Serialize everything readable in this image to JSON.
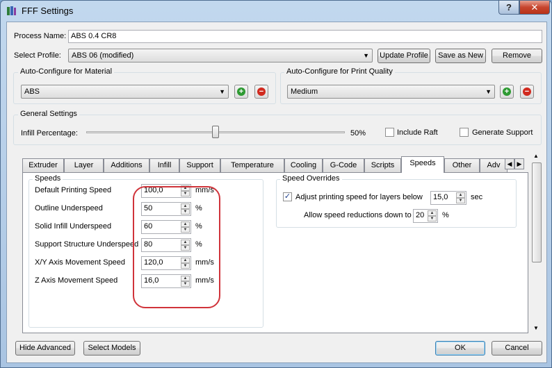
{
  "window": {
    "title": "FFF Settings",
    "help_label": "?",
    "close_label": "✕"
  },
  "process": {
    "label": "Process Name:",
    "value": "ABS 0.4 CR8"
  },
  "profile": {
    "label": "Select Profile:",
    "value": "ABS 06  (modified)",
    "update_label": "Update Profile",
    "save_as_new_label": "Save as New",
    "remove_label": "Remove"
  },
  "material": {
    "title": "Auto-Configure for Material",
    "value": "ABS"
  },
  "quality": {
    "title": "Auto-Configure for Print Quality",
    "value": "Medium"
  },
  "general": {
    "title": "General Settings",
    "infill_label": "Infill Percentage:",
    "infill_value": "50%",
    "infill_fraction": 0.5,
    "include_raft_label": "Include Raft",
    "include_raft_checked": false,
    "generate_support_label": "Generate Support",
    "generate_support_checked": false
  },
  "tabs": [
    "Extruder",
    "Layer",
    "Additions",
    "Infill",
    "Support",
    "Temperature",
    "Cooling",
    "G-Code",
    "Scripts",
    "Speeds",
    "Other",
    "Adv"
  ],
  "active_tab": "Speeds",
  "speeds": {
    "title": "Speeds",
    "rows": [
      {
        "label": "Default Printing Speed",
        "value": "100,0",
        "unit": "mm/s"
      },
      {
        "label": "Outline Underspeed",
        "value": "50",
        "unit": "%"
      },
      {
        "label": "Solid Infill Underspeed",
        "value": "60",
        "unit": "%"
      },
      {
        "label": "Support Structure Underspeed",
        "value": "80",
        "unit": "%"
      },
      {
        "label": "X/Y Axis Movement Speed",
        "value": "120,0",
        "unit": "mm/s"
      },
      {
        "label": "Z Axis Movement Speed",
        "value": "16,0",
        "unit": "mm/s"
      }
    ]
  },
  "overrides": {
    "title": "Speed Overrides",
    "adjust_label": "Adjust printing speed for layers below",
    "adjust_checked": true,
    "adjust_value": "15,0",
    "adjust_unit": "sec",
    "allow_label": "Allow speed reductions down to",
    "allow_value": "20",
    "allow_unit": "%"
  },
  "footer": {
    "hide_advanced_label": "Hide Advanced",
    "select_models_label": "Select Models",
    "ok_label": "OK",
    "cancel_label": "Cancel"
  },
  "colors": {
    "highlight": "#d0333a",
    "plus": "#2e9a32",
    "minus": "#d12a1f"
  }
}
